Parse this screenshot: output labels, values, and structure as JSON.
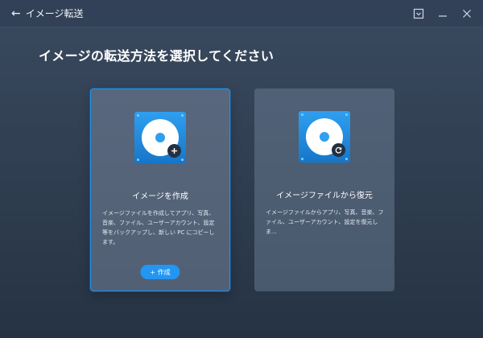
{
  "window": {
    "title": "イメージ転送",
    "back_icon": "arrow-left-icon",
    "controls": [
      "dropdown-icon",
      "minimize-icon",
      "close-icon"
    ]
  },
  "heading": "イメージの転送方法を選択してください",
  "cards": [
    {
      "title": "イメージを作成",
      "description": "イメージファイルを作成してアプリ、写真、音楽、ファイル、ユーザーアカウント、設定等をバックアップし、新しい PC にコピーします。",
      "icon": "disc-add-icon",
      "button_label": "+ 作成",
      "selected": true
    },
    {
      "title": "イメージファイルから復元",
      "description": "イメージファイルからアプリ、写真、音楽、ファイル、ユーザーアカウント、設定を復元しま...",
      "icon": "disc-restore-icon",
      "selected": false
    }
  ],
  "colors": {
    "accent": "#2196f3",
    "selected_border": "#1f8fe8",
    "background": "#2f3d50"
  }
}
